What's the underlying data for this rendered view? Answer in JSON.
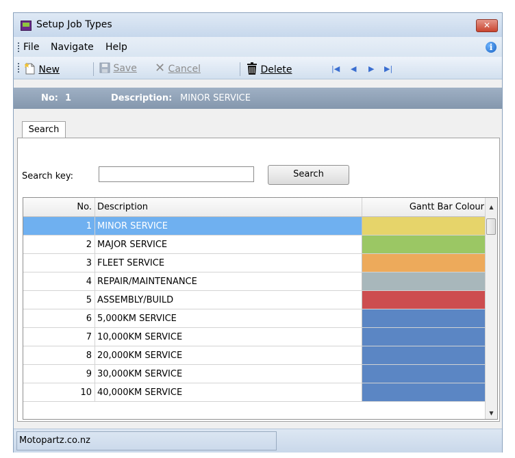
{
  "window": {
    "title": "Setup Job Types",
    "close_label": "✕"
  },
  "menu": {
    "items": [
      "File",
      "Navigate",
      "Help"
    ]
  },
  "toolbar": {
    "new_label": "New",
    "save_label": "Save",
    "cancel_label": "Cancel",
    "delete_label": "Delete"
  },
  "record": {
    "no_label": "No:",
    "no_value": "1",
    "desc_label": "Description:",
    "desc_value": "MINOR SERVICE"
  },
  "tabs": [
    {
      "label": "Search",
      "selected": true
    }
  ],
  "search": {
    "label": "Search key:",
    "value": "",
    "button_label": "Search"
  },
  "grid": {
    "columns": [
      "No.",
      "Description",
      "Gantt Bar Colour"
    ],
    "rows": [
      {
        "no": "1",
        "description": "MINOR SERVICE",
        "colour": "#e6d46a",
        "selected": true
      },
      {
        "no": "2",
        "description": "MAJOR SERVICE",
        "colour": "#9bc764"
      },
      {
        "no": "3",
        "description": "FLEET SERVICE",
        "colour": "#edaa5b"
      },
      {
        "no": "4",
        "description": "REPAIR/MAINTENANCE",
        "colour": "#a8b7bb"
      },
      {
        "no": "5",
        "description": "ASSEMBLY/BUILD",
        "colour": "#cd4d4f"
      },
      {
        "no": "6",
        "description": "5,000KM SERVICE",
        "colour": "#5b86c4"
      },
      {
        "no": "7",
        "description": "10,000KM SERVICE",
        "colour": "#5b86c4"
      },
      {
        "no": "8",
        "description": "20,000KM SERVICE",
        "colour": "#5b86c4"
      },
      {
        "no": "9",
        "description": "30,000KM SERVICE",
        "colour": "#5b86c4"
      },
      {
        "no": "10",
        "description": "40,000KM SERVICE",
        "colour": "#5b86c4"
      }
    ]
  },
  "status": {
    "text": "Motopartz.co.nz"
  },
  "colors": {
    "selection": "#6fb0f0",
    "record_bar": "#8fa2b8"
  }
}
